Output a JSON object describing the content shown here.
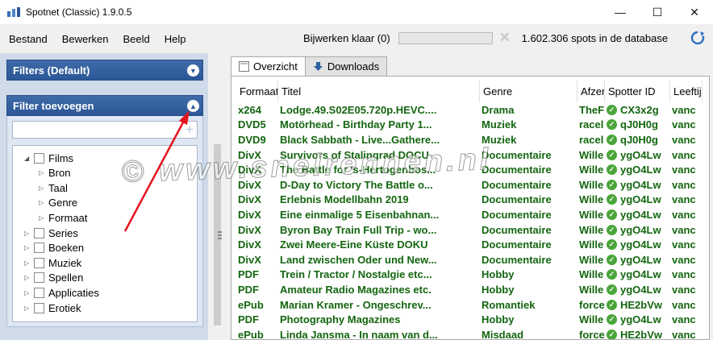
{
  "window": {
    "title": "Spotnet (Classic) 1.9.0.5",
    "min": "—",
    "max": "☐",
    "close": "✕"
  },
  "menu": [
    "Bestand",
    "Bewerken",
    "Beeld",
    "Help"
  ],
  "status": {
    "text": "Bijwerken klaar (0)",
    "progress": 0,
    "count": "1.602.306 spots in de database"
  },
  "left": {
    "filters_header": "Filters (Default)",
    "add_header": "Filter toevoegen",
    "search_placeholder": "",
    "tree": [
      {
        "label": "Films",
        "level": 0,
        "expanded": true
      },
      {
        "label": "Bron",
        "level": 1
      },
      {
        "label": "Taal",
        "level": 1
      },
      {
        "label": "Genre",
        "level": 1
      },
      {
        "label": "Formaat",
        "level": 1
      },
      {
        "label": "Series",
        "level": 0
      },
      {
        "label": "Boeken",
        "level": 0
      },
      {
        "label": "Muziek",
        "level": 0
      },
      {
        "label": "Spellen",
        "level": 0
      },
      {
        "label": "Applicaties",
        "level": 0
      },
      {
        "label": "Erotiek",
        "level": 0
      }
    ]
  },
  "tabs": [
    "Overzicht",
    "Downloads"
  ],
  "columns": [
    "Formaat",
    "Titel",
    "Genre",
    "Afzender",
    "Spotter ID",
    "Leeftijd"
  ],
  "rows": [
    [
      "x264",
      "Lodge.49.S02E05.720p.HEVC....",
      "Drama",
      "TheF",
      "CX3x2g",
      "vanc"
    ],
    [
      "DVD5",
      "Motörhead - Birthday Party 1...",
      "Muziek",
      "racel",
      "qJ0H0g",
      "vanc"
    ],
    [
      "DVD9",
      "Black Sabbath - Live...Gathere...",
      "Muziek",
      "racel",
      "qJ0H0g",
      "vanc"
    ],
    [
      "DivX",
      "Survivors of Stalingrad DOCU",
      "Documentaire",
      "Wille",
      "ygO4Lw",
      "vanc"
    ],
    [
      "DivX",
      "The Battle for 's-Hertogenbos...",
      "Documentaire",
      "Wille",
      "ygO4Lw",
      "vanc"
    ],
    [
      "DivX",
      "D-Day to Victory The Battle o...",
      "Documentaire",
      "Wille",
      "ygO4Lw",
      "vanc"
    ],
    [
      "DivX",
      "Erlebnis Modellbahn 2019",
      "Documentaire",
      "Wille",
      "ygO4Lw",
      "vanc"
    ],
    [
      "DivX",
      "Eine einmalige 5 Eisenbahnan...",
      "Documentaire",
      "Wille",
      "ygO4Lw",
      "vanc"
    ],
    [
      "DivX",
      "Byron Bay Train Full Trip - wo...",
      "Documentaire",
      "Wille",
      "ygO4Lw",
      "vanc"
    ],
    [
      "DivX",
      "Zwei Meere-Eine Küste DOKU",
      "Documentaire",
      "Wille",
      "ygO4Lw",
      "vanc"
    ],
    [
      "DivX",
      "Land zwischen Oder und New...",
      "Documentaire",
      "Wille",
      "ygO4Lw",
      "vanc"
    ],
    [
      "PDF",
      "Trein / Tractor / Nostalgie etc...",
      "Hobby",
      "Wille",
      "ygO4Lw",
      "vanc"
    ],
    [
      "PDF",
      "Amateur Radio Magazines etc.",
      "Hobby",
      "Wille",
      "ygO4Lw",
      "vanc"
    ],
    [
      "ePub",
      "Marian Kramer - Ongeschrev...",
      "Romantiek",
      "force",
      "HE2bVw",
      "vanc"
    ],
    [
      "PDF",
      "Photography Magazines",
      "Hobby",
      "Wille",
      "ygO4Lw",
      "vanc"
    ],
    [
      "ePub",
      "Linda Jansma - In naam van d...",
      "Misdaad",
      "force",
      "HE2bVw",
      "vanc"
    ]
  ],
  "watermark": "© www.snelrennen.nl"
}
